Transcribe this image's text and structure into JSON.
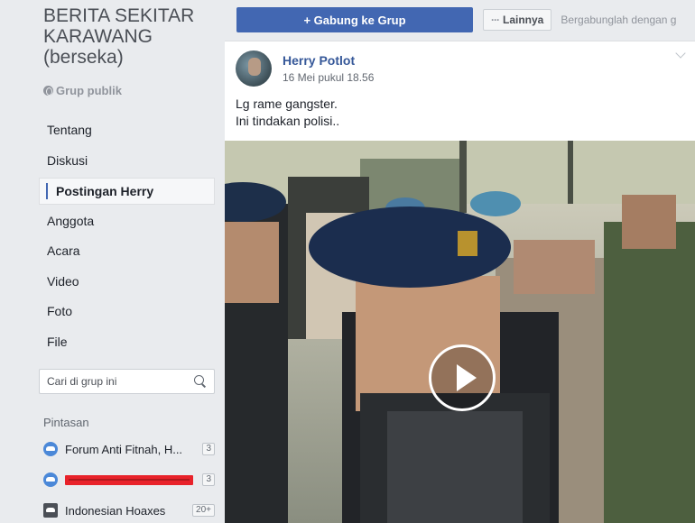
{
  "group": {
    "name": "BERITA SEKITAR KARAWANG (berseka)",
    "type": "Grup publik"
  },
  "nav": [
    {
      "label": "Tentang"
    },
    {
      "label": "Diskusi"
    },
    {
      "label": "Postingan Herry",
      "active": true
    },
    {
      "label": "Anggota"
    },
    {
      "label": "Acara"
    },
    {
      "label": "Video"
    },
    {
      "label": "Foto"
    },
    {
      "label": "File"
    }
  ],
  "search": {
    "placeholder": "Cari di grup ini"
  },
  "shortcuts": {
    "heading": "Pintasan",
    "items": [
      {
        "label": "Forum Anti Fitnah, H...",
        "badge": "3",
        "icon": "group-icon"
      },
      {
        "label": "",
        "badge": "3",
        "icon": "group-icon",
        "redacted": true
      },
      {
        "label": "Indonesian Hoaxes",
        "badge": "20+",
        "icon": "page-thumbnail-icon"
      }
    ]
  },
  "toolbar": {
    "join_label": "+ Gabung ke Grup",
    "more_label": "Lainnya",
    "hint": "Bergabunglah dengan g"
  },
  "post": {
    "author": "Herry Potlot",
    "time": "16 Mei pukul 18.56",
    "text_line1": "Lg rame gangster.",
    "text_line2": "Ini tindakan polisi.."
  },
  "colors": {
    "brand": "#4267b2",
    "link": "#365899",
    "sidebar_bg": "#e9ebee",
    "redaction": "#e8222a"
  }
}
